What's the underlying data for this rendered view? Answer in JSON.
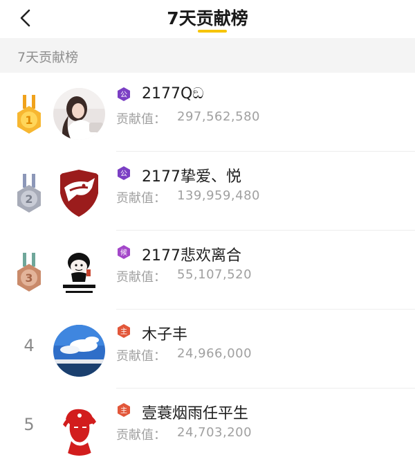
{
  "header": {
    "title": "7天贡献榜",
    "back_icon": "chevron-left-icon",
    "accent_color": "#f6c400"
  },
  "section": {
    "label": "7天贡献榜"
  },
  "value_label": "贡献值：",
  "ranking": [
    {
      "rank": "1",
      "medal": "gold",
      "name": "2177Qඞ",
      "badge": "公",
      "badge_color": "#7b3fc4",
      "value": "297,562,580",
      "avatar": "woman-photo"
    },
    {
      "rank": "2",
      "medal": "silver",
      "name": "2177挚爱、悦",
      "badge": "公",
      "badge_color": "#7b3fc4",
      "value": "139,959,480",
      "avatar": "wolf-shield-logo"
    },
    {
      "rank": "3",
      "medal": "bronze",
      "name": "2177悲欢离合",
      "badge": "候",
      "badge_color": "#a347c9",
      "value": "55,107,520",
      "avatar": "cartoon-meme"
    },
    {
      "rank": "4",
      "medal": "",
      "name": "木子丰",
      "badge": "主",
      "badge_color": "#e2573a",
      "value": "24,966,000",
      "avatar": "sky-photo"
    },
    {
      "rank": "5",
      "medal": "",
      "name": "壹蓑烟雨任平生",
      "badge": "主",
      "badge_color": "#e2573a",
      "value": "24,703,200",
      "avatar": "che-portrait"
    }
  ]
}
